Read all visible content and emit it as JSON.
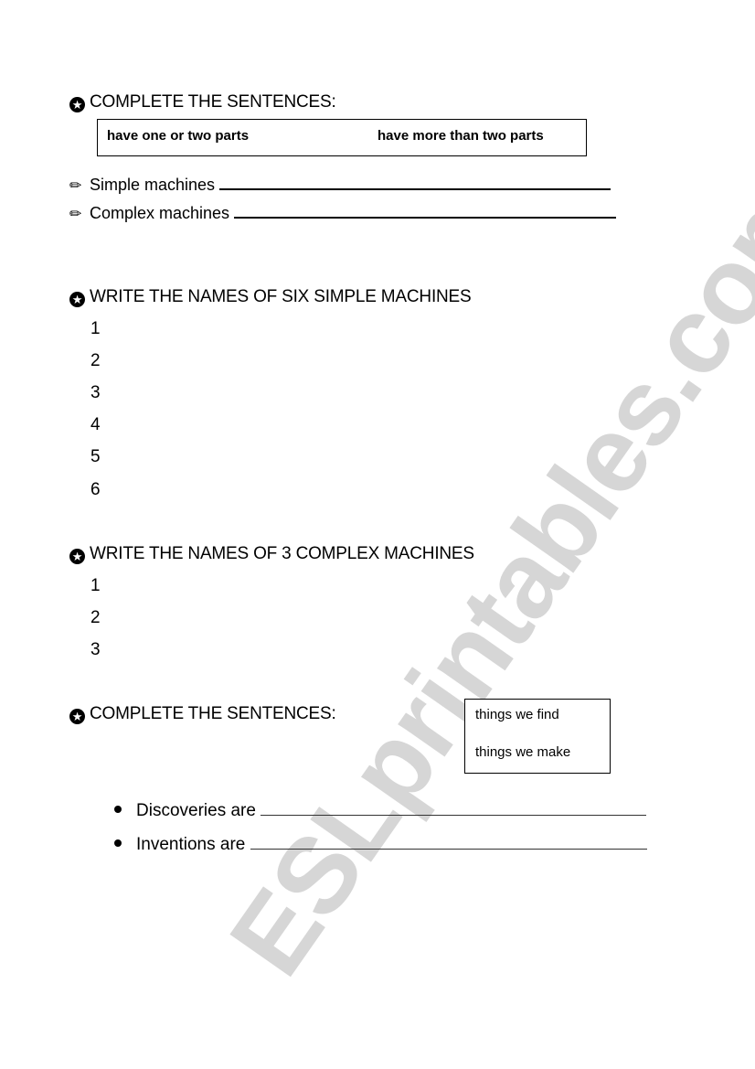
{
  "watermark": "ESLprintables.com",
  "section1": {
    "heading": "COMPLETE THE SENTENCES:",
    "word_box": [
      "have one or two parts",
      "have more than two parts"
    ],
    "sentences": [
      {
        "icon": "pencil-icon",
        "label": "Simple machines"
      },
      {
        "icon": "pencil-icon",
        "label": "Complex machines"
      }
    ]
  },
  "section2": {
    "heading": "WRITE THE NAMES OF SIX SIMPLE MACHINES",
    "numbers": [
      "1",
      "2",
      "3",
      "4",
      "5",
      "6"
    ]
  },
  "section3": {
    "heading": "WRITE THE NAMES OF 3 COMPLEX MACHINES",
    "numbers": [
      "1",
      "2",
      "3"
    ]
  },
  "section4": {
    "heading": "COMPLETE THE SENTENCES:",
    "word_box": [
      "things we find",
      "things we make"
    ],
    "sentences": [
      {
        "label": "Discoveries are"
      },
      {
        "label": "Inventions are"
      }
    ]
  },
  "icons": {
    "heading_bullet": "star-circle-icon",
    "sentence_icon": "pencil-icon",
    "list_bullet": "bullet-icon"
  }
}
